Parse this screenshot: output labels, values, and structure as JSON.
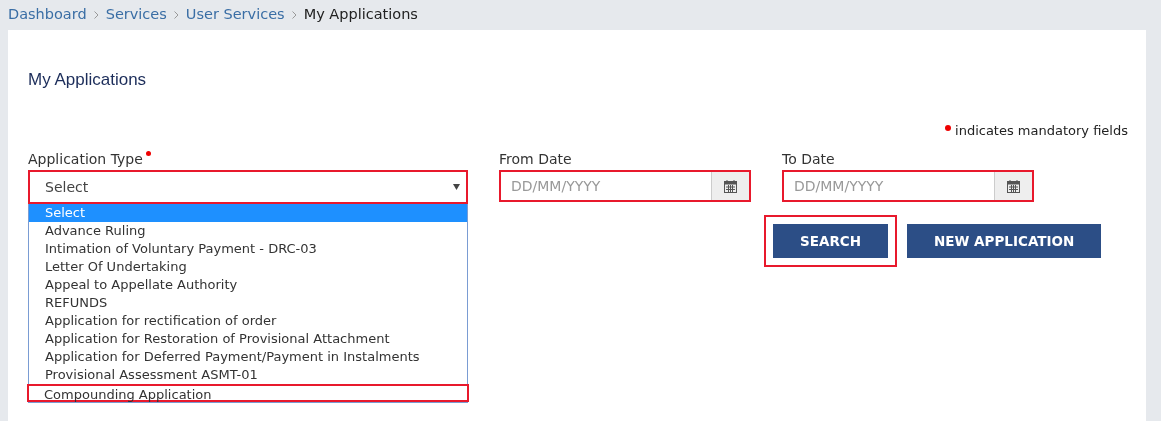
{
  "breadcrumb": [
    {
      "label": "Dashboard",
      "current": false
    },
    {
      "label": "Services",
      "current": false
    },
    {
      "label": "User Services",
      "current": false
    },
    {
      "label": "My Applications",
      "current": true
    }
  ],
  "page_title": "My Applications",
  "mandatory_note": "indicates mandatory fields",
  "application_type": {
    "label": "Application Type",
    "required": true,
    "value": "Select",
    "highlighted": true,
    "options": [
      {
        "label": "Select",
        "selected": true,
        "highlighted": false
      },
      {
        "label": "Advance Ruling",
        "selected": false,
        "highlighted": false
      },
      {
        "label": "Intimation of Voluntary Payment - DRC-03",
        "selected": false,
        "highlighted": false
      },
      {
        "label": "Letter Of Undertaking",
        "selected": false,
        "highlighted": false
      },
      {
        "label": "Appeal to Appellate Authority",
        "selected": false,
        "highlighted": false
      },
      {
        "label": "REFUNDS",
        "selected": false,
        "highlighted": false
      },
      {
        "label": "Application for rectification of order",
        "selected": false,
        "highlighted": false
      },
      {
        "label": "Application for Restoration of Provisional Attachment",
        "selected": false,
        "highlighted": false
      },
      {
        "label": "Application for Deferred Payment/Payment in Instalments",
        "selected": false,
        "highlighted": false
      },
      {
        "label": "Provisional Assessment ASMT-01",
        "selected": false,
        "highlighted": false
      },
      {
        "label": "Compounding Application",
        "selected": false,
        "highlighted": true
      }
    ]
  },
  "date_fields": [
    {
      "label": "From Date",
      "placeholder": "DD/MM/YYYY",
      "highlighted": true
    },
    {
      "label": "To Date",
      "placeholder": "DD/MM/YYYY",
      "highlighted": true
    }
  ],
  "buttons": [
    {
      "label": "SEARCH",
      "highlighted": true
    },
    {
      "label": "NEW APPLICATION",
      "highlighted": false
    }
  ]
}
